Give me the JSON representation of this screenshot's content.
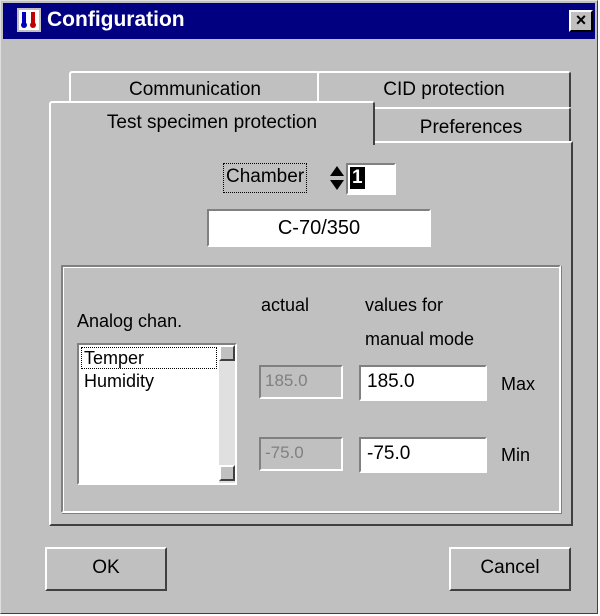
{
  "window": {
    "title": "Configuration",
    "close_symbol": "×",
    "icon": "thermometer-app-icon"
  },
  "tabs": {
    "row_back": [
      "Communication",
      "CID protection"
    ],
    "row_front": [
      "Test specimen protection",
      "Preferences"
    ],
    "active": "Test specimen protection"
  },
  "chamber": {
    "label": "Chamber",
    "value": "1",
    "name": "C-70/350"
  },
  "analog": {
    "label": "Analog chan.",
    "items": [
      "Temper",
      "Humidity"
    ],
    "selected": "Temper"
  },
  "headers": {
    "actual": "actual",
    "manual_line1": "values for",
    "manual_line2": "manual mode"
  },
  "max": {
    "actual": "185.0",
    "manual": "185.0",
    "label": "Max"
  },
  "min": {
    "actual": "-75.0",
    "manual": "-75.0",
    "label": "Min"
  },
  "buttons": {
    "ok": "OK",
    "cancel": "Cancel"
  }
}
